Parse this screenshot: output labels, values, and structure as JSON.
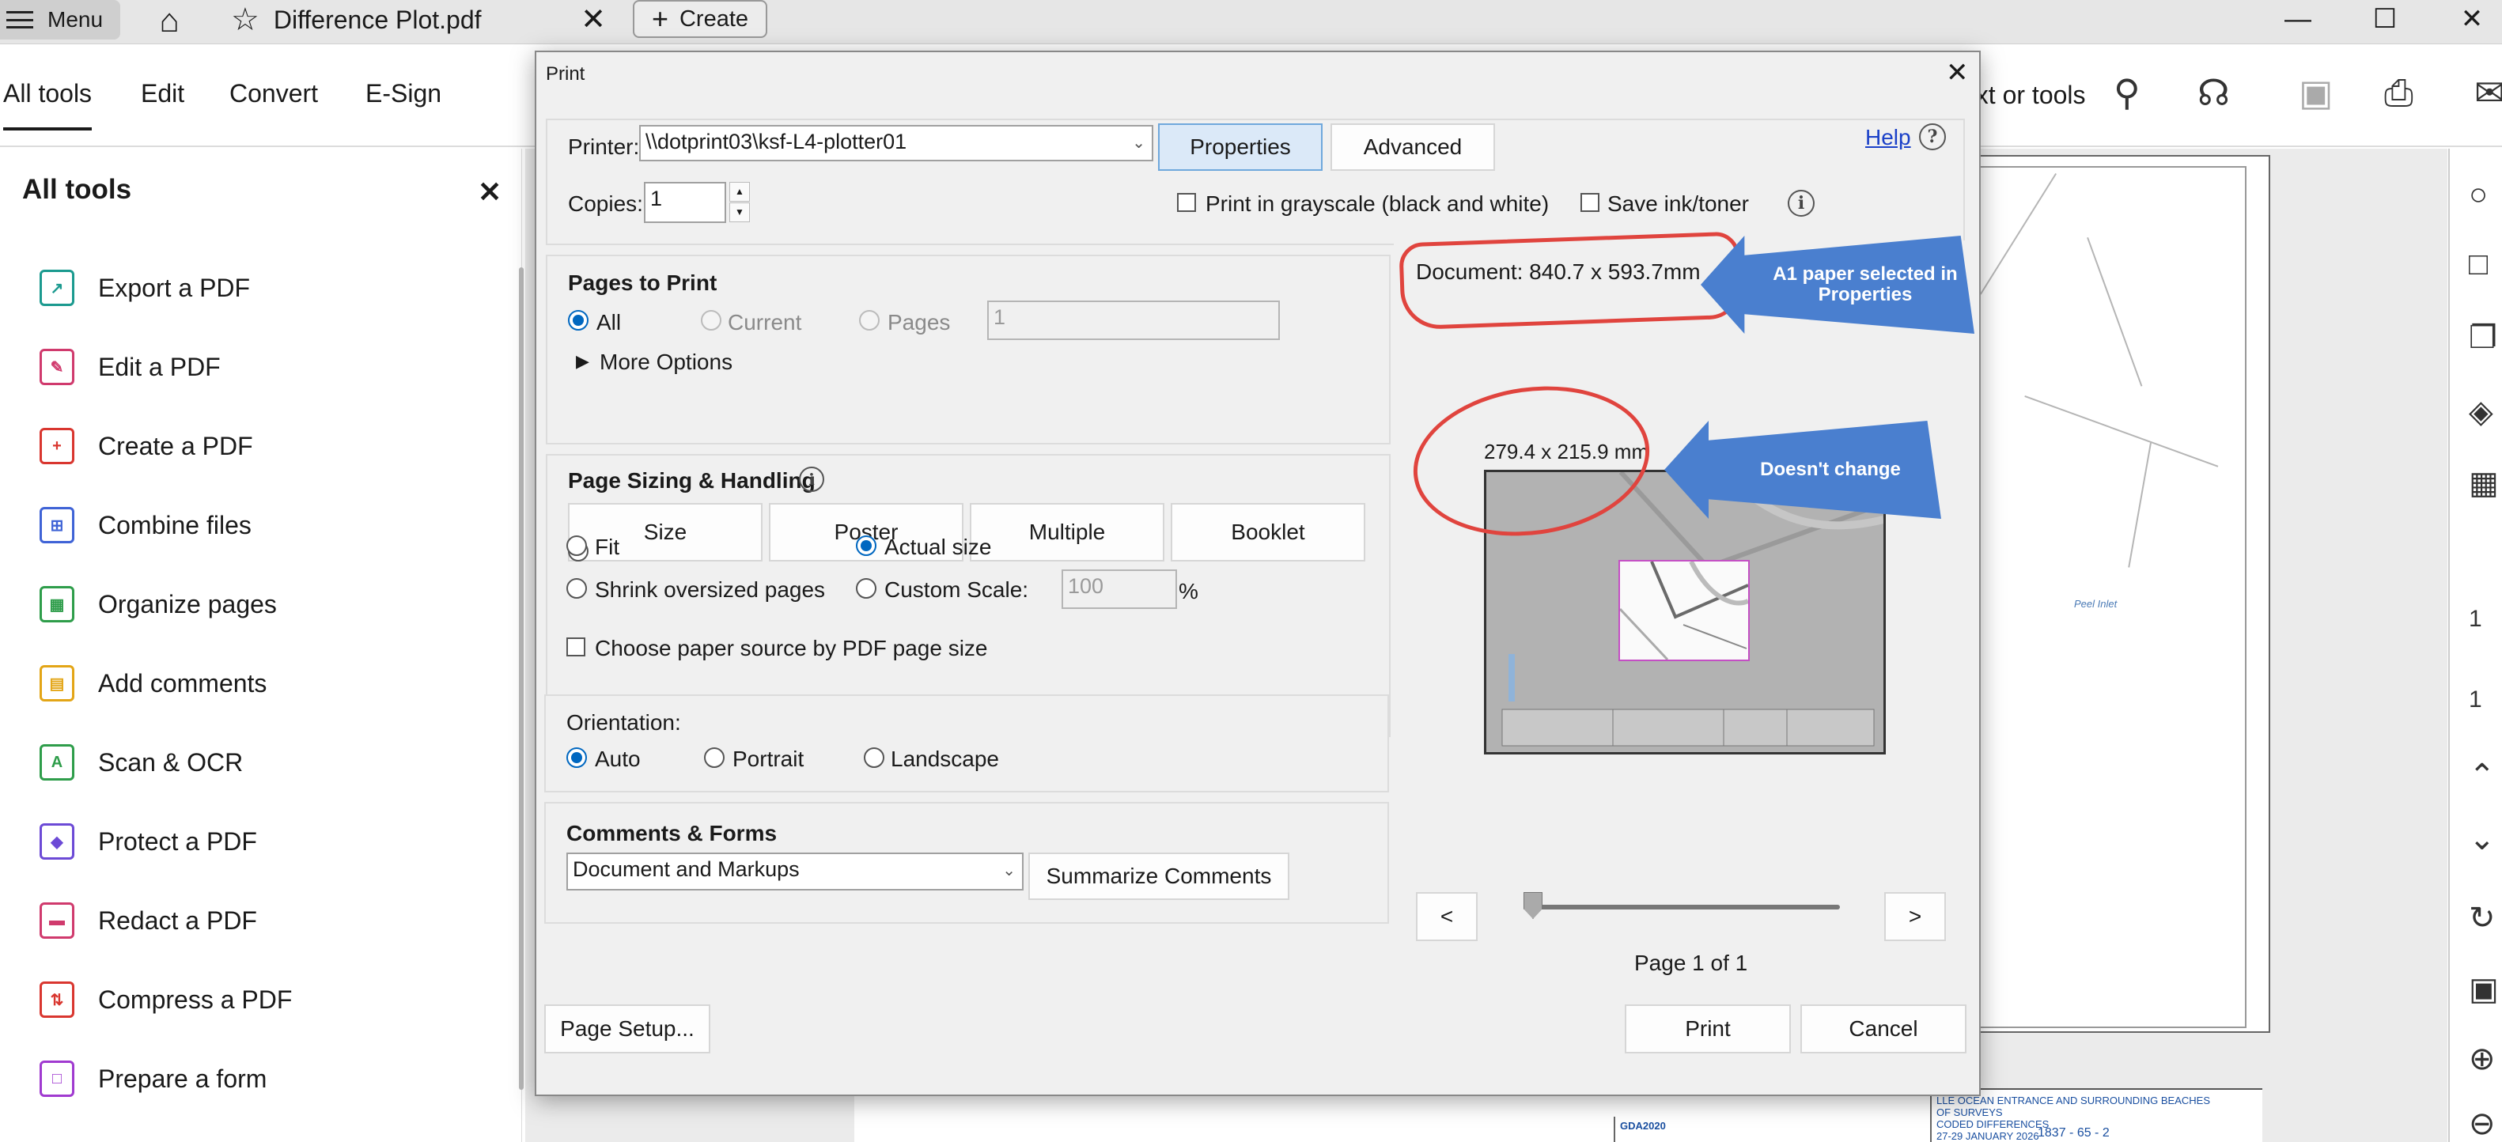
{
  "app": {
    "menu_label": "Menu",
    "tab_title": "Difference Plot.pdf",
    "create_label": "Create"
  },
  "toolbar": {
    "tabs": [
      "All tools",
      "Edit",
      "Convert",
      "E-Sign"
    ],
    "search_text": "ext or tools"
  },
  "left_panel": {
    "title": "All tools",
    "items": [
      {
        "label": "Export a PDF",
        "icon": "export-pdf-icon",
        "color": "#1b9a8f"
      },
      {
        "label": "Edit a PDF",
        "icon": "edit-pdf-icon",
        "color": "#d03a6d"
      },
      {
        "label": "Create a PDF",
        "icon": "create-pdf-icon",
        "color": "#d9362f"
      },
      {
        "label": "Combine files",
        "icon": "combine-files-icon",
        "color": "#3f63d6"
      },
      {
        "label": "Organize pages",
        "icon": "organize-pages-icon",
        "color": "#2e9d4a"
      },
      {
        "label": "Add comments",
        "icon": "add-comments-icon",
        "color": "#e3a516"
      },
      {
        "label": "Scan & OCR",
        "icon": "scan-ocr-icon",
        "color": "#2e9d4a"
      },
      {
        "label": "Protect a PDF",
        "icon": "protect-pdf-icon",
        "color": "#6c4ad6"
      },
      {
        "label": "Redact a PDF",
        "icon": "redact-pdf-icon",
        "color": "#d03a6d"
      },
      {
        "label": "Compress a PDF",
        "icon": "compress-pdf-icon",
        "color": "#d9362f"
      },
      {
        "label": "Prepare a form",
        "icon": "prepare-form-icon",
        "color": "#a03ad0"
      }
    ]
  },
  "dialog": {
    "title": "Print",
    "printer_label": "Printer:",
    "printer_value": "\\\\dotprint03\\ksf-L4-plotter01",
    "properties_label": "Properties",
    "advanced_label": "Advanced",
    "help_label": "Help",
    "copies_label": "Copies:",
    "copies_value": "1",
    "grayscale_label": "Print in grayscale (black and white)",
    "save_ink_label": "Save ink/toner",
    "pages_to_print": {
      "heading": "Pages to Print",
      "all": "All",
      "current": "Current",
      "pages": "Pages",
      "pages_value": "1",
      "more_options": "More Options"
    },
    "sizing": {
      "heading": "Page Sizing & Handling",
      "buttons": [
        "Size",
        "Poster",
        "Multiple",
        "Booklet"
      ],
      "fit": "Fit",
      "actual_size": "Actual size",
      "shrink": "Shrink oversized pages",
      "custom_scale": "Custom Scale:",
      "scale_value": "100",
      "percent": "%",
      "paper_source": "Choose paper source by PDF page size"
    },
    "orientation": {
      "heading": "Orientation:",
      "auto": "Auto",
      "portrait": "Portrait",
      "landscape": "Landscape"
    },
    "comments": {
      "heading": "Comments & Forms",
      "value": "Document and Markups",
      "summarize": "Summarize Comments"
    },
    "preview": {
      "document_size": "Document: 840.7 x 593.7mm",
      "paper_size": "279.4 x 215.9 mm",
      "prev": "<",
      "next": ">",
      "page_indicator": "Page 1 of 1"
    },
    "page_setup_label": "Page Setup...",
    "print_label": "Print",
    "cancel_label": "Cancel"
  },
  "annotations": {
    "callout1": "A1 paper selected in Properties",
    "callout2": "Doesn't change",
    "color": "#e0443e",
    "callout_color": "#4a7fcf"
  },
  "background_doc": {
    "map_label": "Peel Inlet",
    "title_block_1": "LLE OCEAN ENTRANCE AND SURROUNDING BEACHES",
    "title_block_2": "OF SURVEYS",
    "title_block_3": "CODED DIFFERENCES",
    "title_block_4": "27-29 JANUARY 2026",
    "datum": "GDA2020",
    "drawing_number": "1837 - 65 - 2",
    "right_nums": [
      "1",
      "1"
    ]
  }
}
